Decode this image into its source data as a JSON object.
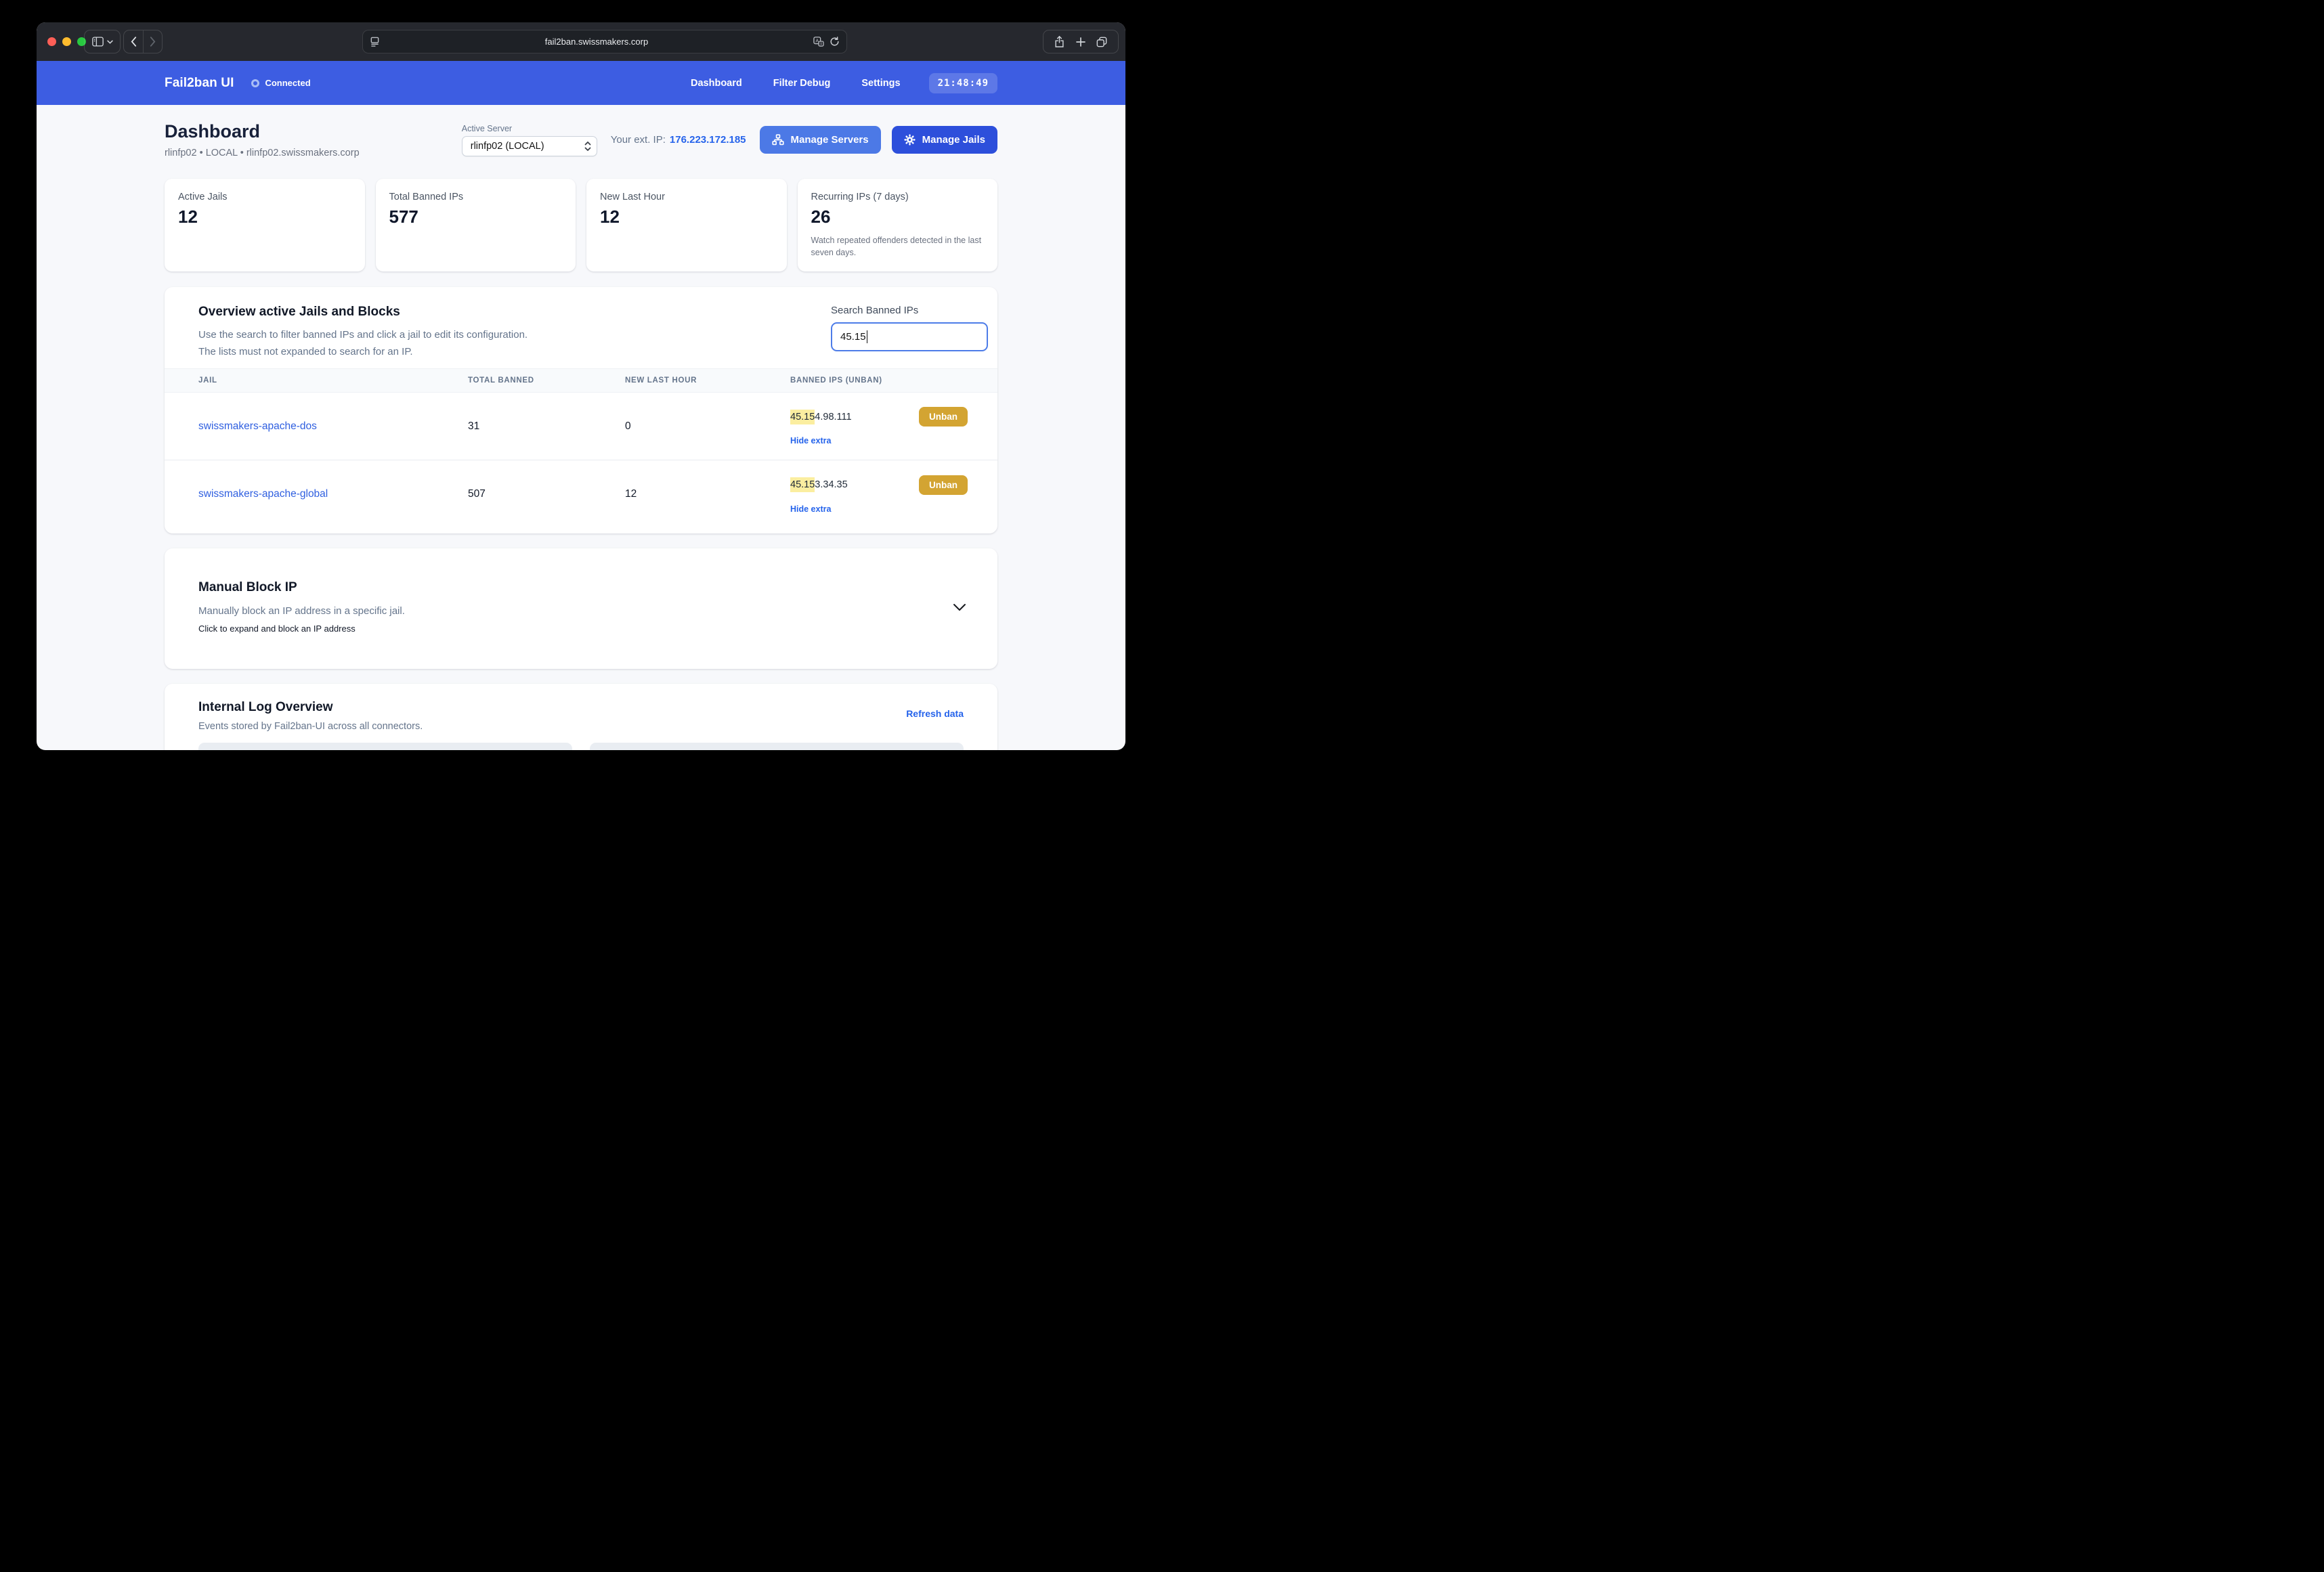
{
  "colors": {
    "header_blue": "#3d5de2",
    "button_blue_light": "#4c79e6",
    "button_blue_dark": "#2d4fdb",
    "link_blue": "#2563eb",
    "unban_amber": "#d3a432",
    "search_highlight_yellow": "#fbeea0",
    "connected_ring": "#a9bcf5"
  },
  "browser": {
    "address": "fail2ban.swissmakers.corp"
  },
  "app_header": {
    "brand": "Fail2ban UI",
    "status": "Connected",
    "nav": [
      {
        "label": "Dashboard"
      },
      {
        "label": "Filter Debug"
      },
      {
        "label": "Settings"
      }
    ],
    "clock": "21:48:49"
  },
  "page_header": {
    "title": "Dashboard",
    "subtitle": "rlinfp02 • LOCAL • rlinfp02.swissmakers.corp",
    "active_server": {
      "label": "Active Server",
      "value": "rlinfp02 (LOCAL)"
    },
    "external_ip": {
      "label": "Your ext. IP:",
      "value": "176.223.172.185"
    },
    "manage_servers_button": "Manage Servers",
    "manage_jails_button": "Manage Jails"
  },
  "stats": {
    "cards": [
      {
        "label": "Active Jails",
        "value": "12"
      },
      {
        "label": "Total Banned IPs",
        "value": "577"
      },
      {
        "label": "New Last Hour",
        "value": "12"
      },
      {
        "label": "Recurring IPs (7 days)",
        "value": "26",
        "description": "Watch repeated offenders detected in the last seven days."
      }
    ]
  },
  "overview": {
    "title": "Overview active Jails and Blocks",
    "description_line_1": "Use the search to filter banned IPs and click a jail to edit its configuration.",
    "description_line_2": "The lists must not expanded to search for an IP.",
    "search": {
      "label": "Search Banned IPs",
      "value": "45.15"
    },
    "table": {
      "headers": [
        "Jail",
        "Total banned",
        "New last hour",
        "Banned IPs (Unban)"
      ],
      "rows": [
        {
          "jail": "swissmakers-apache-dos",
          "total_banned": "31",
          "new_last_hour": "0",
          "banned_ip_match": "45.15",
          "banned_ip_rest": "4.98.111",
          "unban_label": "Unban",
          "toggle_label": "Hide extra"
        },
        {
          "jail": "swissmakers-apache-global",
          "total_banned": "507",
          "new_last_hour": "12",
          "banned_ip_match": "45.15",
          "banned_ip_rest": "3.34.35",
          "unban_label": "Unban",
          "toggle_label": "Hide extra"
        }
      ]
    }
  },
  "manual_block": {
    "title": "Manual Block IP",
    "description": "Manually block an IP address in a specific jail.",
    "hint": "Click to expand and block an IP address"
  },
  "log_overview": {
    "title": "Internal Log Overview",
    "description": "Events stored by Fail2ban-UI across all connectors.",
    "refresh_label": "Refresh data"
  }
}
